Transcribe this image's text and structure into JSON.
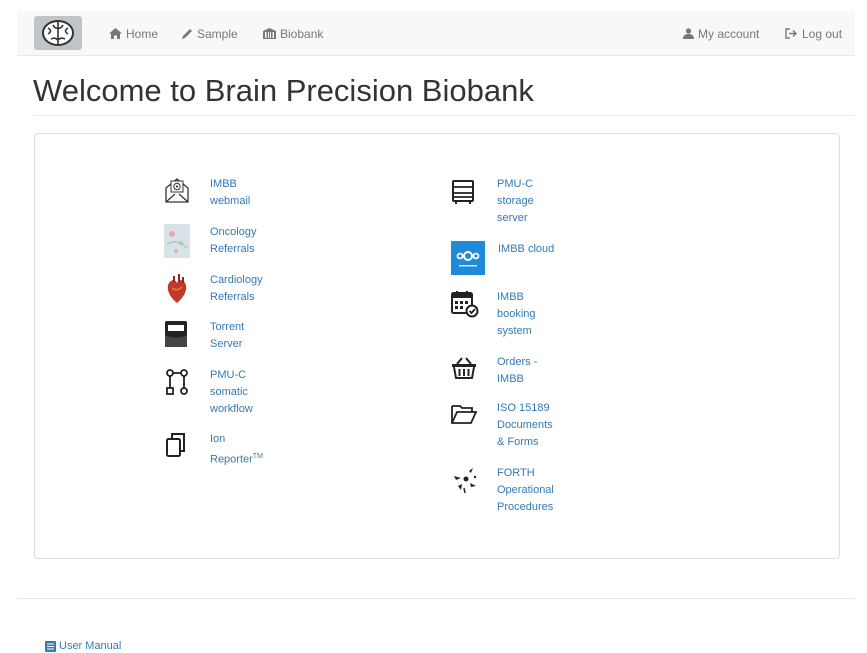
{
  "nav": {
    "home": "Home",
    "sample": "Sample",
    "biobank": "Biobank",
    "account": "My account",
    "logout": "Log out"
  },
  "page": {
    "title": "Welcome to Brain Precision Biobank"
  },
  "left_links": [
    {
      "line1": "IMBB",
      "line2": "webmail",
      "line3": "",
      "icon": "mail-icon"
    },
    {
      "line1": "Oncology",
      "line2": "Referrals",
      "line3": "",
      "icon": "oncology-thumbnail"
    },
    {
      "line1": "Cardiology",
      "line2": "Referrals",
      "line3": "",
      "icon": "heart-icon"
    },
    {
      "line1": "Torrent",
      "line2": "Server",
      "line3": "",
      "icon": "torrent-server-icon"
    },
    {
      "line1": "PMU-C",
      "line2": "somatic",
      "line3": "workflow",
      "icon": "workflow-icon"
    },
    {
      "line1": "Ion",
      "line2": "Reporter",
      "sup": "TM",
      "icon": "copy-icon"
    }
  ],
  "right_links": [
    {
      "line1": "PMU-C",
      "line2": "storage",
      "line3": "server",
      "icon": "server-icon"
    },
    {
      "line1": "IMBB cloud",
      "line2": "",
      "line3": "",
      "icon": "cloud-icon"
    },
    {
      "line1": "IMBB",
      "line2": "booking",
      "line3": "system",
      "icon": "calendar-icon"
    },
    {
      "line1": "Orders -",
      "line2": "IMBB",
      "line3": "",
      "icon": "basket-icon"
    },
    {
      "line1": "ISO 15189",
      "line2": "Documents",
      "line3": "& Forms",
      "icon": "folder-icon"
    },
    {
      "line1": "FORTH",
      "line2": "Operational",
      "line3": "Procedures",
      "icon": "forth-logo-icon"
    }
  ],
  "footer": {
    "manual": "User Manual"
  },
  "colors": {
    "link": "#337ab7",
    "navbar_bg": "#f8f8f8",
    "nav_text": "#777777"
  }
}
